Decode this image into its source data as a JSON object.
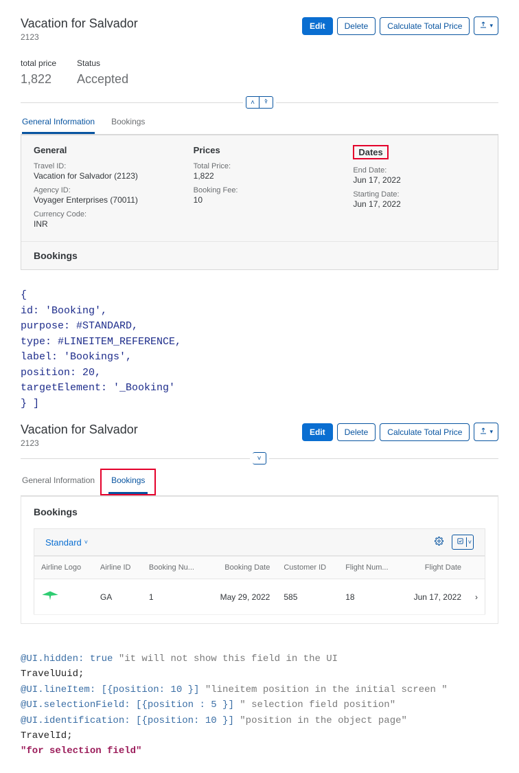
{
  "screenshot1": {
    "header": {
      "title": "Vacation for Salvador",
      "subtitle": "2123",
      "actions": {
        "edit": "Edit",
        "delete": "Delete",
        "calc": "Calculate Total Price"
      }
    },
    "summary": {
      "totalprice_label": "total price",
      "totalprice_value": "1,822",
      "status_label": "Status",
      "status_value": "Accepted"
    },
    "tabs": {
      "general": "General Information",
      "bookings": "Bookings"
    },
    "general": {
      "heading": "General",
      "travelid_label": "Travel ID:",
      "travelid_value": "Vacation for Salvador (2123)",
      "agencyid_label": "Agency ID:",
      "agencyid_value": "Voyager Enterprises (70011)",
      "currency_label": "Currency Code:",
      "currency_value": "INR"
    },
    "prices": {
      "heading": "Prices",
      "totalprice_label": "Total Price:",
      "totalprice_value": "1,822",
      "fee_label": "Booking Fee:",
      "fee_value": "10"
    },
    "dates": {
      "heading": "Dates",
      "end_label": "End Date:",
      "end_value": "Jun 17, 2022",
      "start_label": "Starting Date:",
      "start_value": "Jun 17, 2022"
    },
    "bookings_heading": "Bookings"
  },
  "code1": "{\nid: 'Booking',\npurpose: #STANDARD,\ntype: #LINEITEM_REFERENCE,\nlabel: 'Bookings',\nposition: 20,\ntargetElement: '_Booking'\n} ]",
  "screenshot2": {
    "header": {
      "title": "Vacation for Salvador",
      "subtitle": "2123",
      "actions": {
        "edit": "Edit",
        "delete": "Delete",
        "calc": "Calculate Total Price"
      }
    },
    "tabs": {
      "general": "General Information",
      "bookings": "Bookings"
    },
    "bookings_heading": "Bookings",
    "table": {
      "view_label": "Standard",
      "columns": {
        "logo": "Airline Logo",
        "airline_id": "Airline ID",
        "booking_no": "Booking Nu...",
        "booking_date": "Booking Date",
        "customer_id": "Customer ID",
        "flight_no": "Flight Num...",
        "flight_date": "Flight Date"
      },
      "rows": [
        {
          "logo": "green-wings",
          "airline_id": "GA",
          "booking_no": "1",
          "booking_date": "May 29, 2022",
          "customer_id": "585",
          "flight_no": "18",
          "flight_date": "Jun 17, 2022"
        }
      ]
    }
  },
  "code2": {
    "l1a": "@UI.hidden: true ",
    "l1b": "\"it will not show this field in the UI",
    "l2": "TravelUuid;",
    "l3a": "@UI.lineItem: [{position: 10 }]  ",
    "l3b": "\"lineitem position in the initial screen \"",
    "l4a": "@UI.selectionField: [{position : 5 }] ",
    "l4b": "\" selection field position\"",
    "l5a": "@UI.identification: [{position: 10 }] ",
    "l5b": "\"position in the object page\"",
    "l6": "TravelId;",
    "l7": "\"for selection field\""
  }
}
